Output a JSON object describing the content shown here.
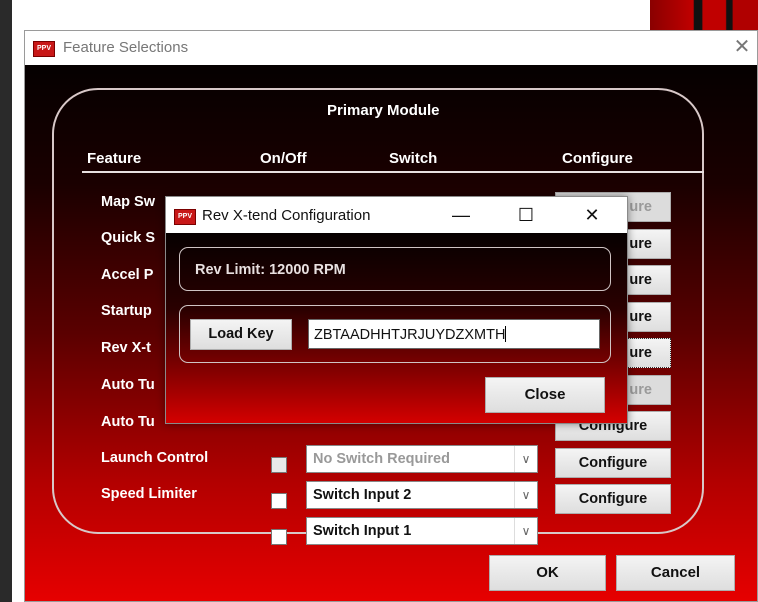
{
  "main_window": {
    "title": "Feature Selections",
    "icon_text": "PPV",
    "close_glyph": "✕"
  },
  "primary_module": {
    "title": "Primary Module",
    "headers": {
      "feature": "Feature",
      "on_off": "On/Off",
      "switch": "Switch",
      "configure": "Configure"
    }
  },
  "features": [
    {
      "label": "Map Sw",
      "switch": "",
      "configure": "ure",
      "configure_enabled": false
    },
    {
      "label": "Quick S",
      "switch": "",
      "configure": "ure",
      "configure_enabled": true
    },
    {
      "label": "Accel P",
      "switch": "",
      "configure": "ure",
      "configure_enabled": true
    },
    {
      "label": "Startup",
      "switch": "",
      "configure": "ure",
      "configure_enabled": true
    },
    {
      "label": "Rev X-t",
      "switch": "",
      "configure": "ure",
      "configure_enabled": true
    },
    {
      "label": "Auto Tu",
      "switch": "",
      "configure": "ure",
      "configure_enabled": false
    },
    {
      "label": "Auto Tu",
      "switch": "No Switch Required",
      "configure": "Configure",
      "configure_enabled": true
    },
    {
      "label": "Launch Control",
      "switch": "Switch Input 2",
      "configure": "Configure",
      "configure_enabled": true
    },
    {
      "label": "Speed Limiter",
      "switch": "Switch Input 1",
      "configure": "Configure",
      "configure_enabled": true
    }
  ],
  "footer": {
    "ok": "OK",
    "cancel": "Cancel"
  },
  "dialog": {
    "title": "Rev X-tend Configuration",
    "icon_text": "PPV",
    "minimize_glyph": "—",
    "maximize_glyph": "☐",
    "close_glyph": "✕",
    "rev_limit": "Rev Limit: 12000 RPM",
    "load_key_label": "Load Key",
    "key_value": "ZBTAADHHTJRJUYDZXMTH",
    "close_label": "Close"
  },
  "colors": {
    "accent_red": "#e60000",
    "dark": "#050000"
  }
}
